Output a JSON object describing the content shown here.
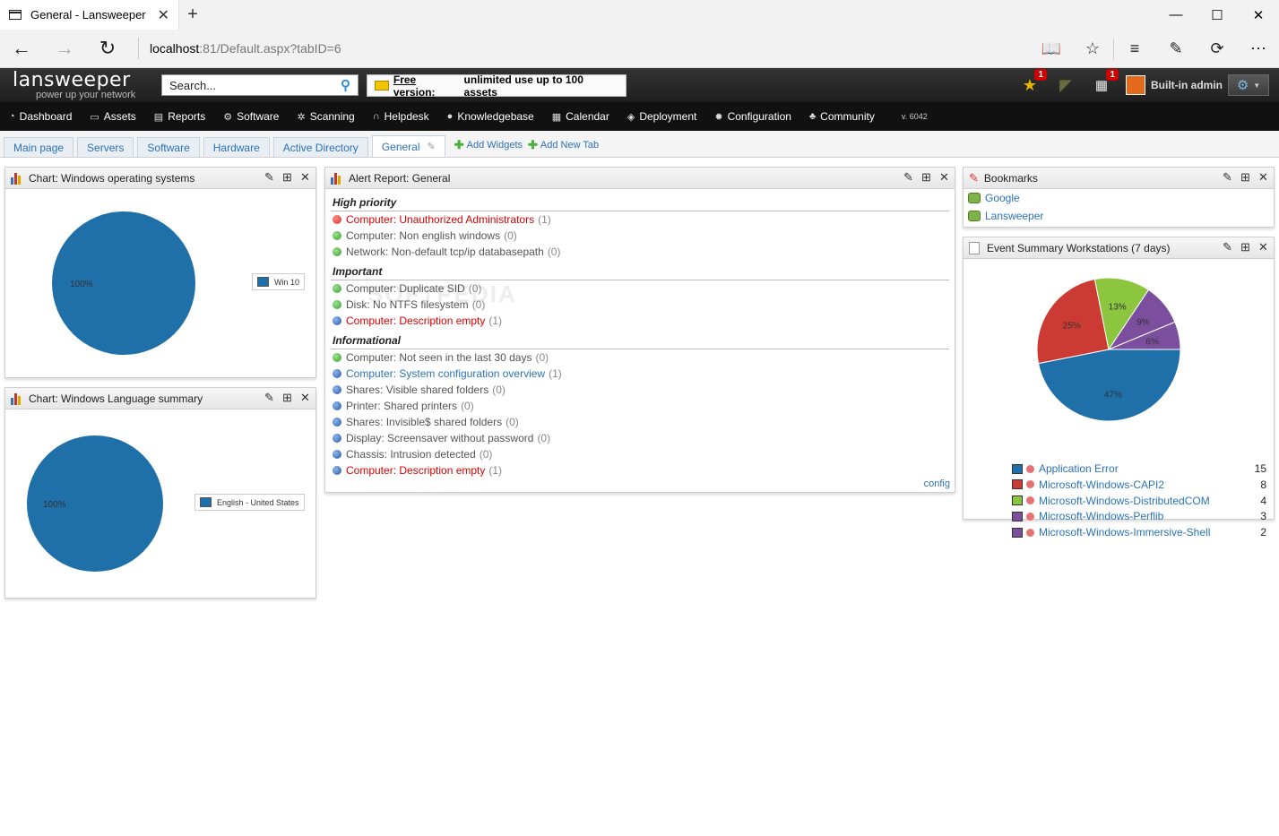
{
  "browser": {
    "tab_title": "General - Lansweeper",
    "url_host": "localhost",
    "url_rest": ":81/Default.aspx?tabID=6"
  },
  "header": {
    "logo_main": "lansweeper",
    "logo_tag": "power up your network",
    "search_placeholder": "Search...",
    "free_link": "Free version:",
    "free_text": "unlimited use up to 100 assets",
    "star_count": "1",
    "calendar_count": "1",
    "user": "Built-in admin"
  },
  "nav": {
    "items": [
      "Dashboard",
      "Assets",
      "Reports",
      "Software",
      "Scanning",
      "Helpdesk",
      "Knowledgebase",
      "Calendar",
      "Deployment",
      "Configuration",
      "Community"
    ],
    "version": "v. 6042"
  },
  "tabs": {
    "items": [
      "Main page",
      "Servers",
      "Software",
      "Hardware",
      "Active Directory",
      "General"
    ],
    "add_widgets": "Add Widgets",
    "add_tab": "Add New Tab"
  },
  "widget_os": {
    "title": "Chart: Windows operating systems",
    "slice_label": "100%",
    "legend": "Win 10"
  },
  "widget_lang": {
    "title": "Chart: Windows Language summary",
    "slice_label": "100%",
    "legend": "English - United States"
  },
  "alert": {
    "title": "Alert Report: General",
    "sections": [
      {
        "name": "High priority",
        "rows": [
          {
            "icon": "red",
            "style": "red",
            "text": "Computer: Unauthorized Administrators",
            "count": "(1)"
          },
          {
            "icon": "green",
            "style": "",
            "text": "Computer: Non english windows",
            "count": "(0)"
          },
          {
            "icon": "green",
            "style": "",
            "text": "Network: Non-default tcp/ip databasepath",
            "count": "(0)"
          }
        ]
      },
      {
        "name": "Important",
        "rows": [
          {
            "icon": "green",
            "style": "",
            "text": "Computer: Duplicate SID",
            "count": "(0)"
          },
          {
            "icon": "green",
            "style": "",
            "text": "Disk: No NTFS filesystem",
            "count": "(0)"
          },
          {
            "icon": "info",
            "style": "red",
            "text": "Computer: Description empty",
            "count": "(1)"
          }
        ]
      },
      {
        "name": "Informational",
        "rows": [
          {
            "icon": "green",
            "style": "",
            "text": "Computer: Not seen in the last 30 days",
            "count": "(0)"
          },
          {
            "icon": "info",
            "style": "blue",
            "text": "Computer: System configuration overview",
            "count": "(1)"
          },
          {
            "icon": "info",
            "style": "",
            "text": "Shares: Visible shared folders",
            "count": "(0)"
          },
          {
            "icon": "info",
            "style": "",
            "text": "Printer: Shared printers",
            "count": "(0)"
          },
          {
            "icon": "info",
            "style": "",
            "text": "Shares: Invisible$ shared folders",
            "count": "(0)"
          },
          {
            "icon": "info",
            "style": "",
            "text": "Display: Screensaver without password",
            "count": "(0)"
          },
          {
            "icon": "info",
            "style": "",
            "text": "Chassis: Intrusion detected",
            "count": "(0)"
          },
          {
            "icon": "info",
            "style": "red",
            "text": "Computer: Description empty",
            "count": "(1)"
          }
        ]
      }
    ],
    "config": "config"
  },
  "bookmarks": {
    "title": "Bookmarks",
    "items": [
      "Google",
      "Lansweeper"
    ]
  },
  "events": {
    "title": "Event Summary Workstations (7 days)",
    "chart_data": {
      "type": "pie",
      "categories": [
        "Application Error",
        "Microsoft-Windows-CAPI2",
        "Microsoft-Windows-DistributedCOM",
        "Microsoft-Windows-Perflib",
        "Microsoft-Windows-Immersive-Shell"
      ],
      "values": [
        15,
        8,
        4,
        3,
        2
      ],
      "labels": [
        "47%",
        "25%",
        "13%",
        "9%",
        "6%"
      ],
      "colors": [
        "#1f6fa8",
        "#cc3b33",
        "#8cc63f",
        "#7b4f9d",
        "#7b4f9d"
      ]
    }
  },
  "watermark": "SOFTPEDIA"
}
